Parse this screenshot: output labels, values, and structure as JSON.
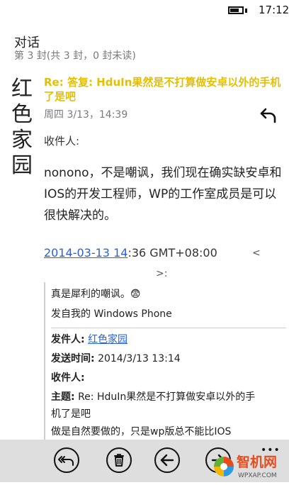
{
  "status_bar": {
    "time": "17:12"
  },
  "conversation": {
    "title": "对话",
    "subtitle": "第 3 封(共 3 封，0 封未读)"
  },
  "message": {
    "sender_name": "红色家园",
    "subject": "Re: 答复: HduIn果然是不打算做安卓以外的手机了是吧",
    "date": "周四 3/13，14:39",
    "recipient_label": "收件人:",
    "body": "nonono，不是嘲讽，我们现在确实缺安卓和IOS的开发工程师，WP的工作室成员是可以很快解决的。"
  },
  "quote": {
    "date_link": "2014-03-13 14",
    "date_rest": ":36 GMT+08:00",
    "lt_glyph": "<",
    "gt_glyph": ">:",
    "line1": "真是犀利的嘲讽。😨",
    "line2": "发自我的 Windows Phone",
    "from_label": "发件人:",
    "from_value": "红色家园",
    "sent_label": "发送时间:",
    "sent_value": "2014/3/13 13:14",
    "to_label": "收件人:",
    "subject_label": "主题:",
    "subject_value_1": "Re: HduIn果然是不打算做安卓以外的手",
    "subject_value_2": "机了是吧",
    "tail": "做是自然要做的，只是wp版总不能比IOS"
  },
  "app_bar": {
    "buttons": [
      "reply-all-icon",
      "delete-icon",
      "back-icon",
      "forward-icon"
    ],
    "more": "•••"
  },
  "watermark": {
    "brand": "智机网",
    "url": "WPXAP.COM"
  },
  "colors": {
    "accent": "#e5bf00",
    "link": "#2a5fd8",
    "app_bar": "#dedede"
  }
}
